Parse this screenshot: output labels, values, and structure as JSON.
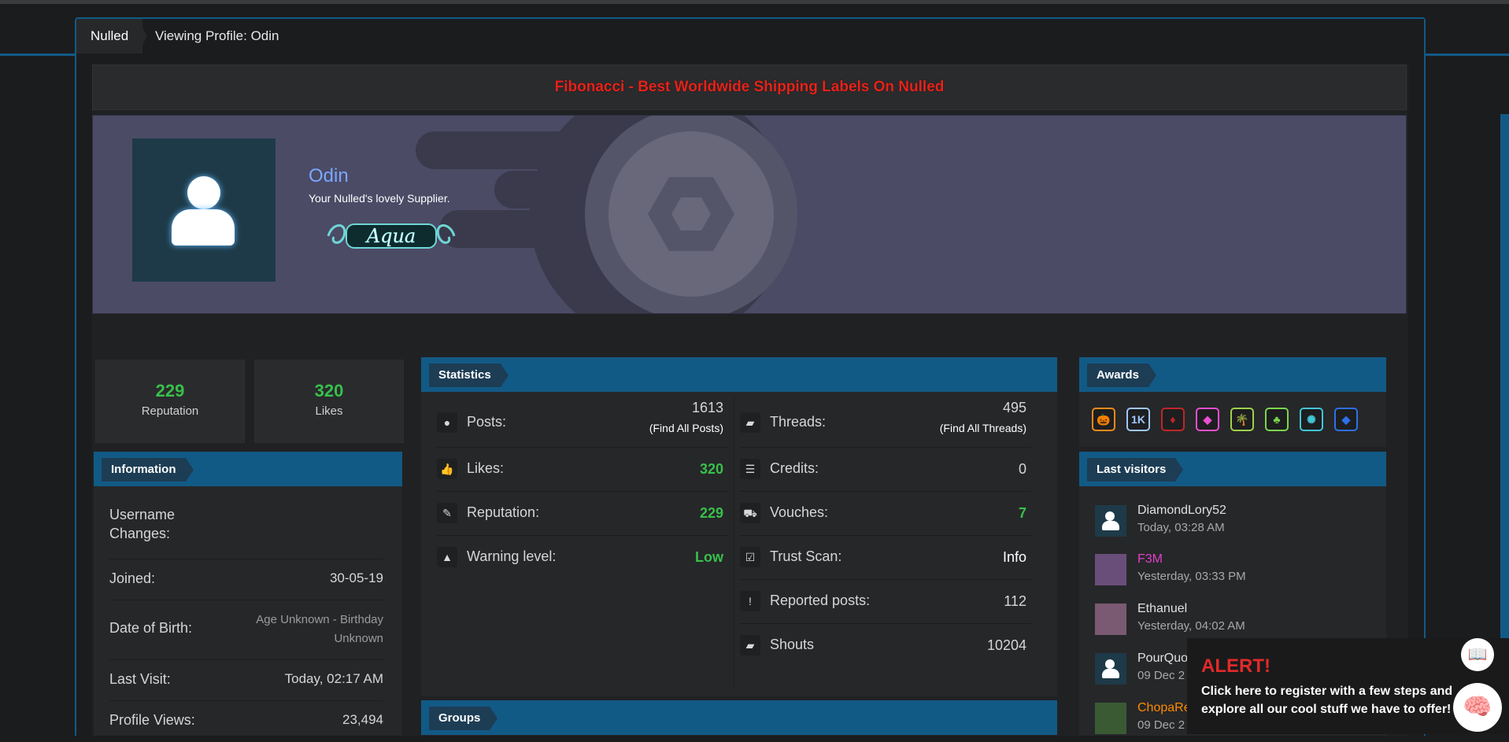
{
  "breadcrumb": {
    "home": "Nulled",
    "current": "Viewing Profile: Odin"
  },
  "banner": {
    "text": "Fibonacci - Best Worldwide Shipping Labels On Nulled"
  },
  "profile": {
    "name": "Odin",
    "subtitle": "Your Nulled's lovely Supplier.",
    "rank_label": "Aqua"
  },
  "summary": {
    "reputation": {
      "value": "229",
      "label": "Reputation"
    },
    "likes": {
      "value": "320",
      "label": "Likes"
    }
  },
  "information": {
    "title": "Information",
    "rows": [
      {
        "label": "Username Changes:",
        "value": ""
      },
      {
        "label": "Joined:",
        "value": "30-05-19"
      },
      {
        "label": "Date of Birth:",
        "value": "Age Unknown - Birthday Unknown"
      },
      {
        "label": "Last Visit:",
        "value": "Today, 02:17 AM"
      },
      {
        "label": "Profile Views:",
        "value": "23,494"
      }
    ]
  },
  "statistics": {
    "title": "Statistics",
    "left": [
      {
        "label": "Posts:",
        "value": "1613",
        "link": "Find All Posts",
        "icon": "comment-icon"
      },
      {
        "label": "Likes:",
        "value": "320",
        "icon": "thumbs-up-icon"
      },
      {
        "label": "Reputation:",
        "value": "229",
        "icon": "ribbon-icon"
      },
      {
        "label": "Warning level:",
        "value": "Low",
        "icon": "warning-icon"
      }
    ],
    "right": [
      {
        "label": "Threads:",
        "value": "495",
        "link": "Find All Threads",
        "icon": "comments-icon"
      },
      {
        "label": "Credits:",
        "value": "0",
        "icon": "coins-icon"
      },
      {
        "label": "Vouches:",
        "value": "7",
        "icon": "cart-icon"
      },
      {
        "label": "Trust Scan:",
        "value": "Info",
        "icon": "checkbox-icon"
      },
      {
        "label": "Reported posts:",
        "value": "112",
        "icon": "exclamation-icon"
      },
      {
        "label": "Shouts",
        "value": "10204",
        "icon": "chat-icon"
      }
    ]
  },
  "groups": {
    "title": "Groups"
  },
  "awards": {
    "title": "Awards",
    "items": [
      {
        "icon": "pumpkin-icon",
        "glyph": "🎃",
        "color": "#f28a1c"
      },
      {
        "icon": "1k-icon",
        "glyph": "1K",
        "color": "#9ec8ff"
      },
      {
        "icon": "ruby-icon",
        "glyph": "♦",
        "color": "#c0262a"
      },
      {
        "icon": "pink-gem-icon",
        "glyph": "◆",
        "color": "#e94fd0"
      },
      {
        "icon": "palm-tree-icon",
        "glyph": "🌴",
        "color": "#9fd14a"
      },
      {
        "icon": "clover-icon",
        "glyph": "♣",
        "color": "#7dd64d"
      },
      {
        "icon": "virus-icon",
        "glyph": "✺",
        "color": "#41c6d8"
      },
      {
        "icon": "diamond-icon",
        "glyph": "◆",
        "color": "#2f6fe8"
      }
    ]
  },
  "last_visitors": {
    "title": "Last visitors",
    "items": [
      {
        "name": "DiamondLory52",
        "time": "Today, 03:28 AM",
        "color": "#e0e0e0"
      },
      {
        "name": "F3M",
        "time": "Yesterday, 03:33 PM",
        "color": "#e040c8"
      },
      {
        "name": "Ethanuel",
        "time": "Yesterday, 04:02 AM",
        "color": "#e0e0e0"
      },
      {
        "name": "PourQuo",
        "time": "09 Dec 2",
        "color": "#e0e0e0"
      },
      {
        "name": "ChopaRe",
        "time": "09 Dec 2",
        "color": "#ff8a00"
      }
    ]
  },
  "alert": {
    "title": "ALERT!",
    "message": "Click here to register with a few steps and explore all our cool stuff we have to offer!"
  }
}
